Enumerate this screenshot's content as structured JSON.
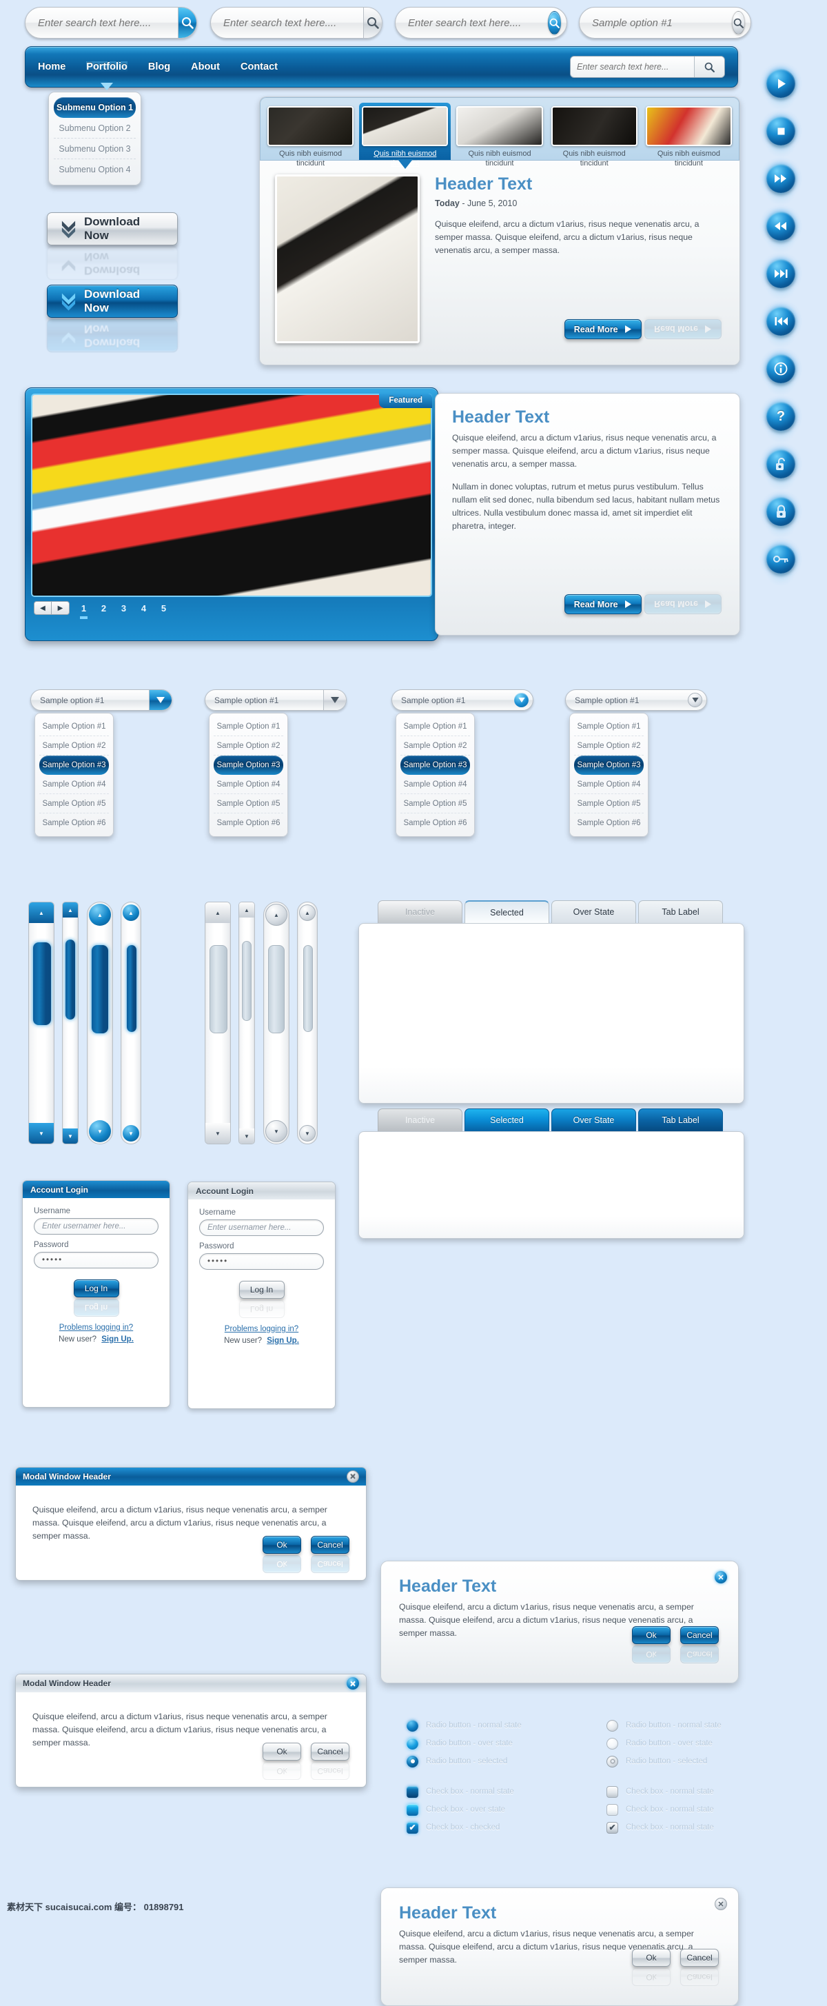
{
  "search_bars": [
    {
      "placeholder": "Enter search text here....",
      "button": "search-icon",
      "style": "blue-square"
    },
    {
      "placeholder": "Enter search text here....",
      "button": "search-icon",
      "style": "grey-square"
    },
    {
      "placeholder": "Enter search text here....",
      "button": "search-icon",
      "style": "blue-circle"
    },
    {
      "placeholder": "Sample option #1",
      "button": "search-icon",
      "style": "grey-circle"
    }
  ],
  "nav": {
    "links": [
      {
        "label": "Home",
        "active": false
      },
      {
        "label": "Portfolio",
        "active": true
      },
      {
        "label": "Blog",
        "active": false
      },
      {
        "label": "About",
        "active": false
      },
      {
        "label": "Contact",
        "active": false
      }
    ],
    "search_placeholder": "Enter search text here..."
  },
  "submenu": {
    "items": [
      {
        "label": "Submenu Option 1",
        "selected": true
      },
      {
        "label": "Submenu Option 2",
        "selected": false
      },
      {
        "label": "Submenu Option 3",
        "selected": false
      },
      {
        "label": "Submenu Option 4",
        "selected": false
      }
    ]
  },
  "download_buttons": [
    {
      "label": "Download Now",
      "style": "grey"
    },
    {
      "label": "Download Now",
      "style": "blue"
    }
  ],
  "gallery": {
    "thumbs": [
      {
        "caption_line1": "Quis nibh euismod",
        "caption_line2": "tincidunt",
        "selected": false
      },
      {
        "caption_line1": "Quis nibh euismod",
        "caption_line2": "tincidunt",
        "selected": true
      },
      {
        "caption_line1": "Quis nibh euismod",
        "caption_line2": "tincidunt",
        "selected": false
      },
      {
        "caption_line1": "Quis nibh euismod",
        "caption_line2": "tincidunt",
        "selected": false
      },
      {
        "caption_line1": "Quis nibh euismod",
        "caption_line2": "tincidunt",
        "selected": false
      }
    ],
    "header": "Header Text",
    "date_prefix": "Today",
    "date_sep": " - ",
    "date": "June 5, 2010",
    "body": "Quisque eleifend, arcu a dictum v1arius, risus neque venenatis arcu, a semper massa. Quisque eleifend, arcu a dictum v1arius, risus neque venenatis arcu, a semper massa.",
    "read_more": "Read More"
  },
  "featured": {
    "badge": "Featured",
    "prev": "◀",
    "next": "▶",
    "pages": [
      "1",
      "2",
      "3",
      "4",
      "5"
    ],
    "active_page": "1",
    "header": "Header Text",
    "body_p1": "Quisque eleifend, arcu a dictum v1arius, risus neque venenatis arcu, a semper massa. Quisque eleifend, arcu a dictum v1arius, risus neque venenatis arcu, a semper massa.",
    "body_p2": "Nullam in donec voluptas, rutrum et metus purus vestibulum. Tellus nullam elit sed donec, nulla bibendum sed lacus, habitant nullam metus ultrices. Nulla vestibulum donec massa id, amet sit imperdiet elit pharetra, integer.",
    "read_more": "Read More"
  },
  "dropdowns": {
    "selected_value": "Sample option #1",
    "options": [
      {
        "label": "Sample Option #1",
        "selected": false
      },
      {
        "label": "Sample Option #2",
        "selected": false
      },
      {
        "label": "Sample Option #3",
        "selected": true
      },
      {
        "label": "Sample Option #4",
        "selected": false
      },
      {
        "label": "Sample Option #5",
        "selected": false
      },
      {
        "label": "Sample Option #6",
        "selected": false
      }
    ],
    "variants": [
      "blue-square-caret",
      "grey-square-caret",
      "blue-circle-caret",
      "grey-circle-caret"
    ]
  },
  "scrollbars": {
    "up_arrow": "▲",
    "down_arrow": "▼",
    "blue_variants": [
      "square-wide",
      "square-narrow",
      "round-wide",
      "round-narrow"
    ],
    "grey_variants": [
      "square-wide",
      "square-narrow",
      "round-wide",
      "round-narrow"
    ]
  },
  "tabs": {
    "grey_set": [
      {
        "label": "Inactive",
        "state": "inactive"
      },
      {
        "label": "Selected",
        "state": "selected"
      },
      {
        "label": "Over State",
        "state": "over"
      },
      {
        "label": "Tab Label",
        "state": "label"
      }
    ],
    "blue_set": [
      {
        "label": "Inactive",
        "state": "inactive"
      },
      {
        "label": "Selected",
        "state": "selected"
      },
      {
        "label": "Over State",
        "state": "over"
      },
      {
        "label": "Tab Label",
        "state": "label"
      }
    ]
  },
  "login": {
    "title": "Account Login",
    "username_label": "Username",
    "username_placeholder": "Enter usernamer here...",
    "password_label": "Password",
    "password_value": "•••••",
    "button": "Log In",
    "problems_link": "Problems logging in?",
    "new_user_text": "New user?",
    "signup_link": "Sign Up."
  },
  "modals": {
    "window_title": "Modal Window Header",
    "header_text": "Header Text",
    "body": "Quisque eleifend, arcu a dictum v1arius, risus neque venenatis arcu, a semper massa. Quisque eleifend, arcu a dictum v1arius, risus neque venenatis arcu, a semper massa.",
    "ok": "Ok",
    "cancel": "Cancel",
    "close": "✕"
  },
  "media_buttons": [
    {
      "icon": "play-icon",
      "glyph": "▶"
    },
    {
      "icon": "stop-icon",
      "glyph": "■"
    },
    {
      "icon": "fast-forward-icon",
      "glyph": "▶▶"
    },
    {
      "icon": "rewind-icon",
      "glyph": "◀◀"
    },
    {
      "icon": "next-track-icon",
      "glyph": "▶▶|"
    },
    {
      "icon": "previous-track-icon",
      "glyph": "|◀◀"
    },
    {
      "icon": "info-icon",
      "glyph": "ℹ"
    },
    {
      "icon": "help-icon",
      "glyph": "?"
    },
    {
      "icon": "unlock-icon",
      "glyph": "⚿"
    },
    {
      "icon": "lock-icon",
      "glyph": "🔒"
    },
    {
      "icon": "key-icon",
      "glyph": "⚷"
    }
  ],
  "controls": {
    "blue_column": [
      {
        "type": "radio",
        "state": "b-norm",
        "label": "Radio button - normal state"
      },
      {
        "type": "radio",
        "state": "b-over",
        "label": "Radio button - over state"
      },
      {
        "type": "radio",
        "state": "b-sel",
        "label": "Radio button - selected"
      },
      {
        "type": "check",
        "state": "b-norm",
        "label": "Check box - normal state"
      },
      {
        "type": "check",
        "state": "b-over",
        "label": "Check box - over state"
      },
      {
        "type": "check",
        "state": "b-chk",
        "label": "Check box - checked"
      }
    ],
    "grey_column": [
      {
        "type": "radio",
        "state": "g-norm",
        "label": "Radio button - normal state"
      },
      {
        "type": "radio",
        "state": "g-over",
        "label": "Radio button - over state"
      },
      {
        "type": "radio",
        "state": "g-sel",
        "label": "Radio button - selected"
      },
      {
        "type": "check",
        "state": "g-norm",
        "label": "Check box - normal state"
      },
      {
        "type": "check",
        "state": "g-over",
        "label": "Check box - normal state"
      },
      {
        "type": "check",
        "state": "g-chk",
        "label": "Check box - normal state"
      }
    ],
    "check_glyph": "✔"
  },
  "footer": {
    "watermark": "素材天下 sucaisucai.com  编号： 01898791"
  },
  "colors": {
    "page_bg": "#dceafa",
    "accent_blue": "#0a5d9c",
    "header_text": "#4a8fc4",
    "link_blue": "#2a6fab"
  }
}
